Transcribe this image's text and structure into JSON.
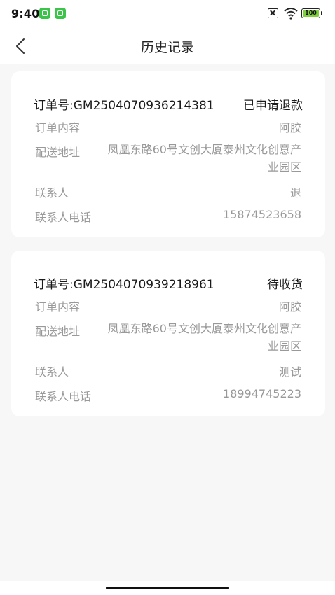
{
  "status_bar": {
    "time": "9:40",
    "battery": "100",
    "icons": [
      "app-notification-icon",
      "app-notification-icon",
      "no-sim-icon",
      "wifi-icon",
      "battery-icon"
    ],
    "battery_color": "#7fd13b"
  },
  "navbar": {
    "back_icon": "chevron-left-icon",
    "title": "历史记录"
  },
  "orders": [
    {
      "order_no": "订单号:GM2504070936214381",
      "status": "已申请退款",
      "content_label": "订单内容",
      "content_value": "阿胶",
      "address_label": "配送地址",
      "address_value": "凤凰东路60号文创大厦泰州文化创意产业园区",
      "contact_label": "联系人",
      "contact_value": "退",
      "phone_label": "联系人电话",
      "phone_value": "15874523658"
    },
    {
      "order_no": "订单号:GM2504070939218961",
      "status": "待收货",
      "content_label": "订单内容",
      "content_value": "阿胶",
      "address_label": "配送地址",
      "address_value": "凤凰东路60号文创大厦泰州文化创意产业园区",
      "contact_label": "联系人",
      "contact_value": "测试",
      "phone_label": "联系人电话",
      "phone_value": "18994745223"
    }
  ],
  "colors": {
    "background": "#f7f7f7",
    "card": "#ffffff",
    "primary_text": "#1a1a1a",
    "secondary_text": "#999999"
  }
}
